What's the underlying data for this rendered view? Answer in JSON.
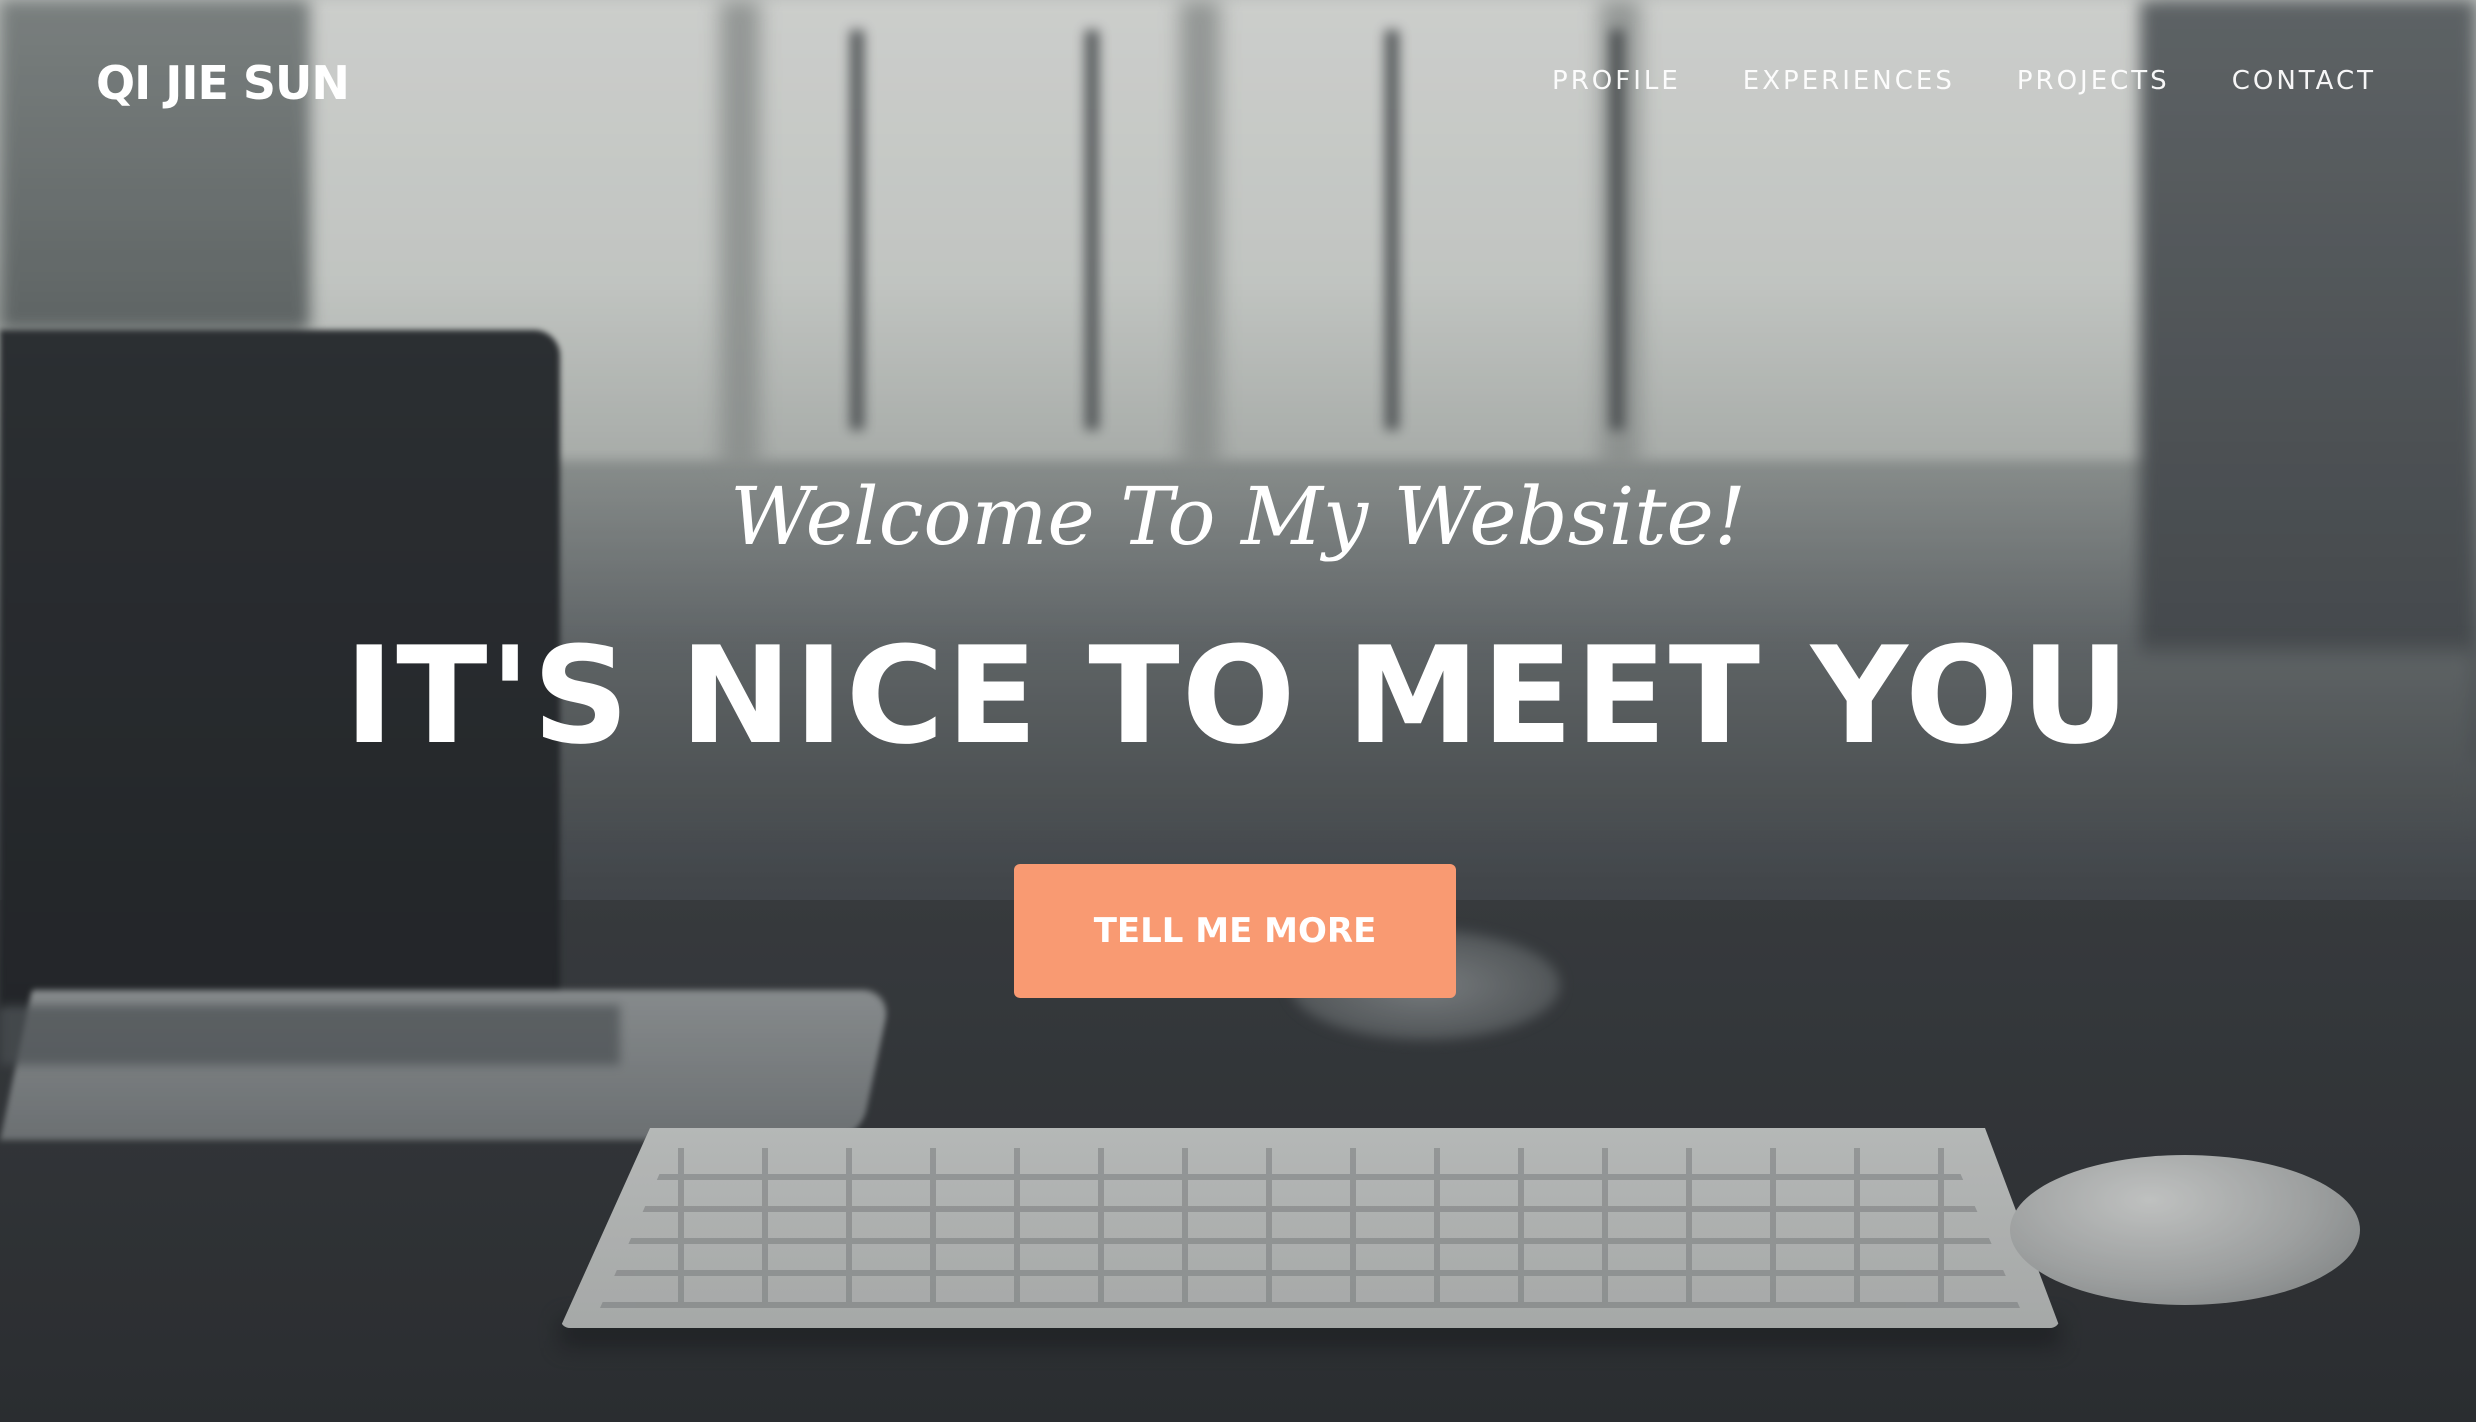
{
  "brand": {
    "name": "QI JIE SUN"
  },
  "nav": {
    "items": [
      {
        "label": "PROFILE"
      },
      {
        "label": "EXPERIENCES"
      },
      {
        "label": "PROJECTS"
      },
      {
        "label": "CONTACT"
      }
    ]
  },
  "hero": {
    "subtitle": "Welcome To My Website!",
    "title": "IT'S NICE TO MEET YOU",
    "cta_label": "TELL ME MORE"
  },
  "colors": {
    "accent": "#f99a72",
    "text": "#ffffff"
  }
}
